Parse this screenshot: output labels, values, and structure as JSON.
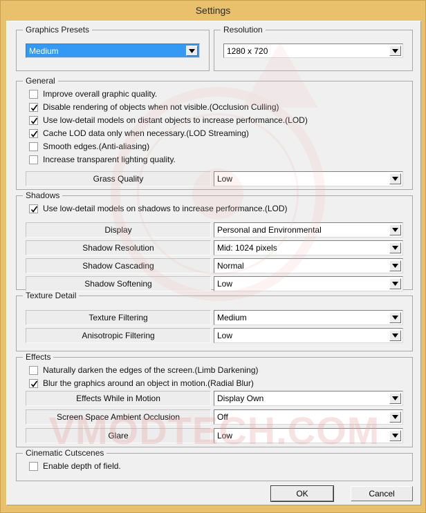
{
  "window": {
    "title": "Settings"
  },
  "watermark": {
    "text": "VMODTECH.COM"
  },
  "groups": {
    "graphics_presets": {
      "title": "Graphics Presets",
      "preset": {
        "label": "graphics-preset-select",
        "value": "Medium",
        "selected": true
      }
    },
    "resolution": {
      "title": "Resolution",
      "resolution": {
        "value": "1280 x 720"
      }
    },
    "general": {
      "title": "General",
      "checkboxes": [
        {
          "label": "Improve overall graphic quality.",
          "checked": false
        },
        {
          "label": "Disable rendering of objects when not visible.(Occlusion Culling)",
          "checked": true
        },
        {
          "label": "Use low-detail models on distant objects to increase performance.(LOD)",
          "checked": true
        },
        {
          "label": "Cache LOD data only when necessary.(LOD Streaming)",
          "checked": true
        },
        {
          "label": "Smooth edges.(Anti-aliasing)",
          "checked": false
        },
        {
          "label": "Increase transparent lighting quality.",
          "checked": false
        }
      ],
      "rows": [
        {
          "label": "Grass Quality",
          "value": "Low"
        }
      ]
    },
    "shadows": {
      "title": "Shadows",
      "checkboxes": [
        {
          "label": "Use low-detail models on shadows to increase performance.(LOD)",
          "checked": true
        }
      ],
      "rows": [
        {
          "label": "Display",
          "value": "Personal and Environmental"
        },
        {
          "label": "Shadow Resolution",
          "value": "Mid: 1024 pixels"
        },
        {
          "label": "Shadow Cascading",
          "value": "Normal"
        },
        {
          "label": "Shadow Softening",
          "value": "Low"
        }
      ]
    },
    "texture_detail": {
      "title": "Texture Detail",
      "rows": [
        {
          "label": "Texture Filtering",
          "value": "Medium"
        },
        {
          "label": "Anisotropic Filtering",
          "value": "Low"
        }
      ]
    },
    "effects": {
      "title": "Effects",
      "checkboxes": [
        {
          "label": "Naturally darken the edges of the screen.(Limb Darkening)",
          "checked": false
        },
        {
          "label": "Blur the graphics around an object in motion.(Radial Blur)",
          "checked": true
        }
      ],
      "rows": [
        {
          "label": "Effects While in Motion",
          "value": "Display Own"
        },
        {
          "label": "Screen Space Ambient Occlusion",
          "value": "Off"
        },
        {
          "label": "Glare",
          "value": "Low"
        }
      ]
    },
    "cinematic_cutscenes": {
      "title": "Cinematic Cutscenes",
      "checkboxes": [
        {
          "label": "Enable depth of field.",
          "checked": false
        }
      ]
    }
  },
  "buttons": {
    "ok": "OK",
    "cancel": "Cancel"
  },
  "colors": {
    "titlebar": "#E9C16C",
    "dialog_bg": "#F0F0F0",
    "selection_blue": "#3399F5",
    "watermark_red": "#E8A0A0"
  }
}
